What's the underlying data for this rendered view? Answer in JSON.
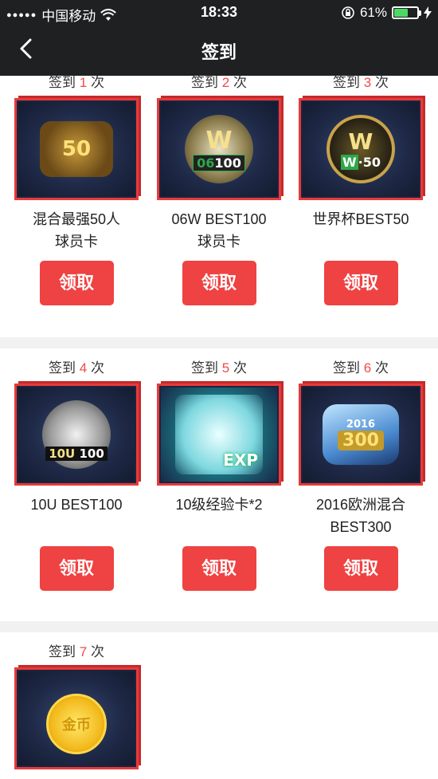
{
  "status_bar": {
    "carrier": "中国移动",
    "time": "18:33",
    "battery": "61%",
    "battery_level": 0.61
  },
  "nav": {
    "title": "签到",
    "back_icon": "chevron-left-icon"
  },
  "items": [
    {
      "prefix": "签到",
      "num": "1",
      "suffix": "次",
      "name_line1": "混合最强50人",
      "name_line2": "球员卡",
      "button": "领取",
      "icon": "player-card-50-icon"
    },
    {
      "prefix": "签到",
      "num": "2",
      "suffix": "次",
      "name_line1": "06W BEST100",
      "name_line2": "球员卡",
      "button": "领取",
      "icon": "w-best100-badge-icon"
    },
    {
      "prefix": "签到",
      "num": "3",
      "suffix": "次",
      "name_line1": "世界杯BEST50",
      "name_line2": "",
      "button": "领取",
      "icon": "w-best50-badge-icon"
    },
    {
      "prefix": "签到",
      "num": "4",
      "suffix": "次",
      "name_line1": "10U BEST100",
      "name_line2": "",
      "button": "领取",
      "icon": "soccer-ball-badge-icon"
    },
    {
      "prefix": "签到",
      "num": "5",
      "suffix": "次",
      "name_line1": "10级经验卡*2",
      "name_line2": "",
      "button": "领取",
      "icon": "exp-card-icon"
    },
    {
      "prefix": "签到",
      "num": "6",
      "suffix": "次",
      "name_line1": "2016欧洲混合",
      "name_line2": "BEST300",
      "button": "领取",
      "icon": "2016-best300-badge-icon"
    },
    {
      "prefix": "签到",
      "num": "7",
      "suffix": "次",
      "name_line1": "",
      "name_line2": "",
      "button": "",
      "icon": "gold-coin-icon"
    }
  ],
  "badge_text": {
    "b1": "50",
    "b2": "100",
    "b2_prefix": "06",
    "b3": "50",
    "b3_prefix": "W",
    "b4": "100",
    "b4_prefix": "10U",
    "b5": "EXP",
    "b6_year": "2016",
    "b6": "300",
    "b7": "金币"
  },
  "colors": {
    "accent": "#ef4242",
    "header_bg": "#1f2022",
    "card_bg": "#1a2440",
    "battery_fill": "#4cd964"
  }
}
